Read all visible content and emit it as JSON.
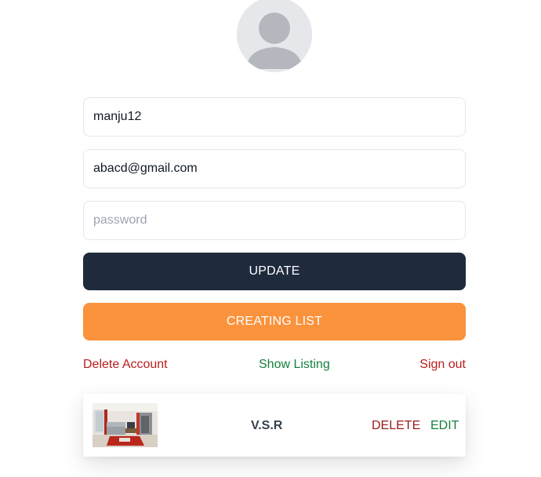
{
  "profile": {
    "avatar_icon": "user-avatar-icon",
    "username": "manju12",
    "email": "abacd@gmail.com",
    "password_placeholder": "password"
  },
  "actions": {
    "update_label": "UPDATE",
    "create_label": "CREATING LIST"
  },
  "links": {
    "delete_account": "Delete Account",
    "show_listing": "Show Listing",
    "sign_out": "Sign out"
  },
  "listings": [
    {
      "name": "V.S.R",
      "delete_label": "DELETE",
      "edit_label": "EDIT"
    }
  ],
  "colors": {
    "update_button": "#1f2a3d",
    "create_button": "#fb923c",
    "danger_text": "#b91c1c",
    "success_text": "#15803d"
  }
}
